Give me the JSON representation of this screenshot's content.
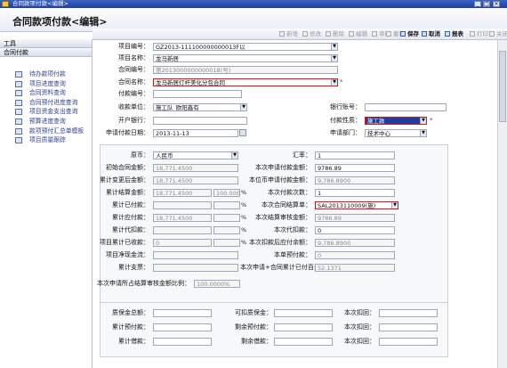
{
  "window": {
    "title": "合同款项付款<编辑>"
  },
  "header": {
    "title": "合同款项付款<编辑>"
  },
  "sidebar": {
    "sections": [
      "工具",
      "合同付款"
    ],
    "items": [
      "待办款项付款",
      "项目进度查询",
      "合同资料查询",
      "合同预付进度查询",
      "项目资金支出查询",
      "预算进度查询",
      "款项预付汇总单模板",
      "项目质量跟踪"
    ]
  },
  "toolbar": {
    "buttons": [
      "新增",
      "修改",
      "删除",
      "编辑",
      "审核",
      "撤审",
      "保存",
      "取消",
      "报表",
      "打印",
      "关闭"
    ]
  },
  "form": {
    "project_no_label": "项目编号：",
    "project_no": "GZ2013-111100000000013F以",
    "project_name_label": "项目名称：",
    "project_name": "龙马新居",
    "contract_no_label": "合同编号：",
    "contract_no": "第2013000000000018(号)",
    "contract_name_label": "合同名称：",
    "contract_name": "龙马新居灯杆美化分包合同",
    "pay_no_label": "付款编号：",
    "pay_no": "",
    "payee_label": "收款单位：",
    "payee": "施工队_欧阳鑫有",
    "bank_account_label": "银行账号：",
    "bank_account": "",
    "bank_label": "开户银行：",
    "bank": "",
    "pay_nature_label": "付款性质：",
    "pay_nature": "施工款",
    "apply_date_label": "申请付款日期：",
    "apply_date": "2013-11-13",
    "apply_dept_label": "申请部门：",
    "apply_dept": "技术中心",
    "currency_label": "原币：",
    "currency": "人民币",
    "rate_label": "汇率：",
    "rate": "1",
    "initial_amount_label": "初始合同金额：",
    "initial_amount": "18,771.4500",
    "apply_amount_label": "本次申请付款金额：",
    "apply_amount": "9786.89",
    "cum_change_label": "累计变更后金额：",
    "cum_change": "18,771.4500",
    "local_amount_label": "本位币申请付款金额：",
    "local_amount": "9,786.8900",
    "cum_settle_label": "累计结算金额：",
    "cum_settle": "18,771.4500",
    "cum_settle_pct": "100.0000",
    "pay_count_label": "本次付款次数：",
    "pay_count": "1",
    "cum_paid_label": "累计已付款：",
    "cum_paid": "",
    "cum_paid_pct": "",
    "settle_no_label": "本次合同结算单：",
    "settle_no": "SAL2013110009(施)",
    "cum_payable_label": "累计应付款：",
    "cum_payable": "18,771.4500",
    "cum_payable_pct": "",
    "settle_amount_label": "本次结算审核金额：",
    "settle_amount": "9786.89",
    "cum_deduct_label": "累计代扣款：",
    "cum_deduct": "",
    "cum_deduct_pct": "",
    "deduct_label": "本次代扣款：",
    "deduct": "0",
    "proj_received_label": "项目累计已收款：",
    "proj_received": "0",
    "proj_received_pct": "",
    "after_deduct_label": "本次扣款后应付余额：",
    "after_deduct": "9,786.8900",
    "cash_flow_label": "项目净现金流：",
    "cash_flow": "",
    "unit_advance_label": "本单预付款：",
    "unit_advance": "0",
    "cum_stat_label": "累计支票：",
    "cum_stat": "",
    "cum_pct_label": "本次申请+合同累计已付百分比：",
    "cum_pct": "52.1371",
    "settle_ratio_label": "本次申请所占结算审核金额比例：",
    "settle_ratio": "100.0000%",
    "deposit_total_label": "质保金总额：",
    "deposit_total": "",
    "deductible_label": "可扣质保金：",
    "deductible": "",
    "this_deduct1_label": "本次扣回：",
    "this_deduct1": "",
    "cum_prepay_label": "累计预付款：",
    "cum_prepay": "",
    "remain_prepay_label": "剩余预付款：",
    "remain_prepay": "",
    "this_deduct2_label": "本次扣回：",
    "this_deduct2": "",
    "cum_borrow_label": "累计借款：",
    "cum_borrow": "",
    "remain_borrow_label": "剩余借款：",
    "remain_borrow": "",
    "this_deduct3_label": "本次扣回：",
    "this_deduct3": "",
    "pct_sign": "%"
  }
}
